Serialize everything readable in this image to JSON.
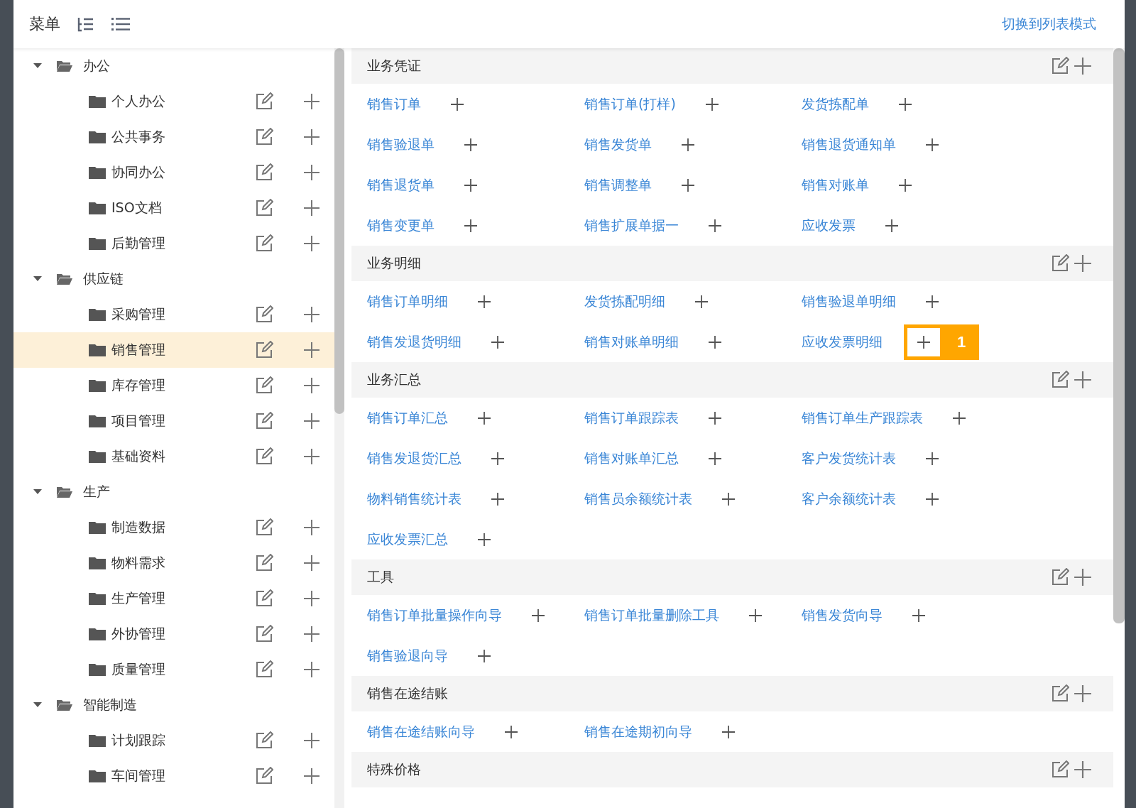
{
  "header": {
    "title": "菜单",
    "switch_link": "切换到列表模式"
  },
  "tree": [
    {
      "label": "办公",
      "expanded": true,
      "children": [
        {
          "label": "个人办公",
          "selected": false
        },
        {
          "label": "公共事务",
          "selected": false
        },
        {
          "label": "协同办公",
          "selected": false
        },
        {
          "label": "ISO文档",
          "selected": false
        },
        {
          "label": "后勤管理",
          "selected": false
        }
      ]
    },
    {
      "label": "供应链",
      "expanded": true,
      "children": [
        {
          "label": "采购管理",
          "selected": false
        },
        {
          "label": "销售管理",
          "selected": true
        },
        {
          "label": "库存管理",
          "selected": false
        },
        {
          "label": "项目管理",
          "selected": false
        },
        {
          "label": "基础资料",
          "selected": false
        }
      ]
    },
    {
      "label": "生产",
      "expanded": true,
      "children": [
        {
          "label": "制造数据",
          "selected": false
        },
        {
          "label": "物料需求",
          "selected": false
        },
        {
          "label": "生产管理",
          "selected": false
        },
        {
          "label": "外协管理",
          "selected": false
        },
        {
          "label": "质量管理",
          "selected": false
        }
      ]
    },
    {
      "label": "智能制造",
      "expanded": true,
      "children": [
        {
          "label": "计划跟踪",
          "selected": false
        },
        {
          "label": "车间管理",
          "selected": false
        }
      ]
    }
  ],
  "sections": [
    {
      "title": "业务凭证",
      "links": [
        {
          "label": "销售订单"
        },
        {
          "label": "销售订单(打样)"
        },
        {
          "label": "发货拣配单"
        },
        {
          "label": "销售验退单"
        },
        {
          "label": "销售发货单"
        },
        {
          "label": "销售退货通知单"
        },
        {
          "label": "销售退货单"
        },
        {
          "label": "销售调整单"
        },
        {
          "label": "销售对账单"
        },
        {
          "label": "销售变更单"
        },
        {
          "label": "销售扩展单据一"
        },
        {
          "label": "应收发票"
        }
      ]
    },
    {
      "title": "业务明细",
      "links": [
        {
          "label": "销售订单明细"
        },
        {
          "label": "发货拣配明细"
        },
        {
          "label": "销售验退单明细"
        },
        {
          "label": "销售发退货明细"
        },
        {
          "label": "销售对账单明细"
        },
        {
          "label": "应收发票明细",
          "callout": "1"
        }
      ]
    },
    {
      "title": "业务汇总",
      "links": [
        {
          "label": "销售订单汇总"
        },
        {
          "label": "销售订单跟踪表"
        },
        {
          "label": "销售订单生产跟踪表"
        },
        {
          "label": "销售发退货汇总"
        },
        {
          "label": "销售对账单汇总"
        },
        {
          "label": "客户发货统计表"
        },
        {
          "label": "物料销售统计表"
        },
        {
          "label": "销售员余额统计表"
        },
        {
          "label": "客户余额统计表"
        },
        {
          "label": "应收发票汇总"
        }
      ]
    },
    {
      "title": "工具",
      "links": [
        {
          "label": "销售订单批量操作向导"
        },
        {
          "label": "销售订单批量删除工具"
        },
        {
          "label": "销售发货向导"
        },
        {
          "label": "销售验退向导"
        }
      ]
    },
    {
      "title": "销售在途结账",
      "links": [
        {
          "label": "销售在途结账向导"
        },
        {
          "label": "销售在途期初向导"
        }
      ]
    },
    {
      "title": "特殊价格"
    }
  ]
}
